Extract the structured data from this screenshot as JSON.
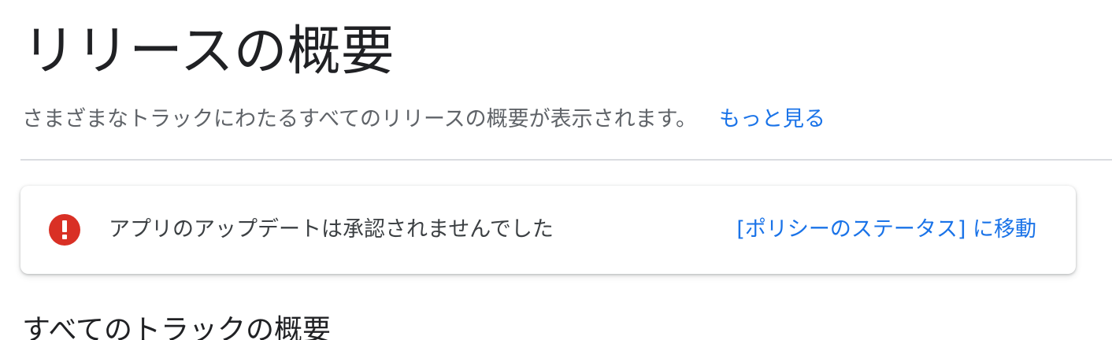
{
  "header": {
    "title": "リリースの概要",
    "description": "さまざまなトラックにわたるすべてのリリースの概要が表示されます。",
    "learn_more_label": "もっと見る"
  },
  "alert": {
    "severity_icon": "error-icon",
    "message": "アプリのアップデートは承認されませんでした",
    "action_label": "[ポリシーのステータス] に移動",
    "color": "#d93025"
  },
  "section": {
    "heading": "すべてのトラックの概要"
  },
  "colors": {
    "link": "#1a73e8",
    "error": "#d93025",
    "divider": "#dadce0"
  }
}
